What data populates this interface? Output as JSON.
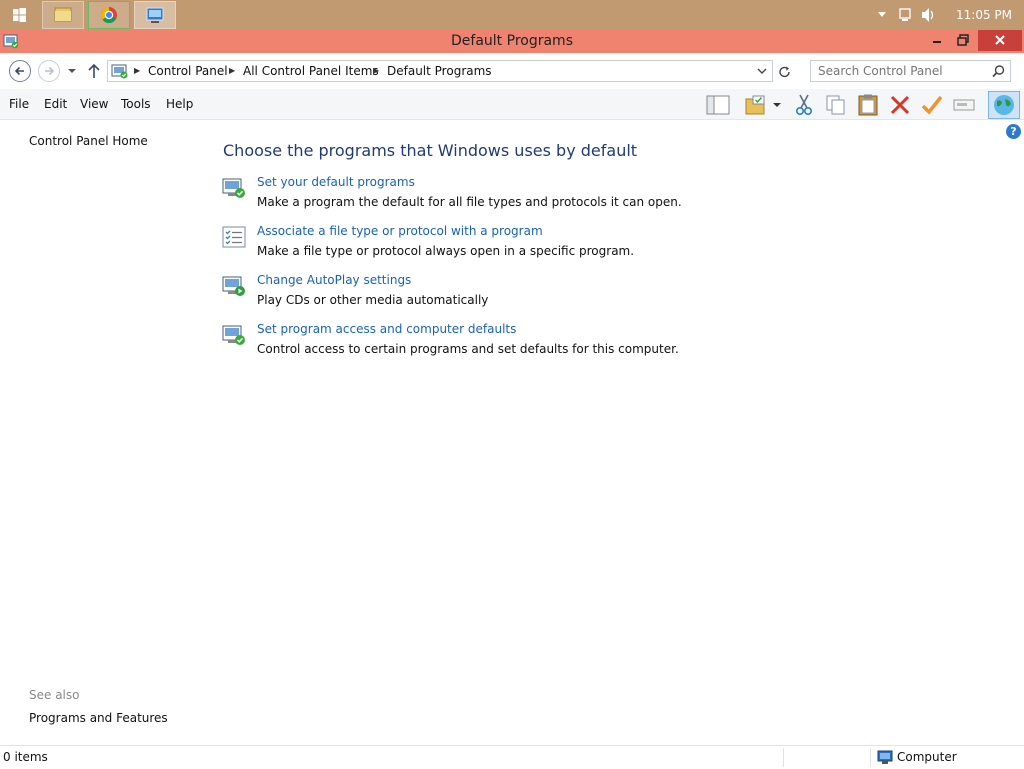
{
  "taskbar": {
    "apps": [
      "start-icon",
      "file-explorer-icon",
      "chrome-icon",
      "control-panel-icon"
    ],
    "clock": "11:05 PM",
    "tray_icons": [
      "chevron-up-icon",
      "network-icon",
      "volume-icon"
    ]
  },
  "window": {
    "title": "Default Programs",
    "title_color": "#f0836f"
  },
  "address": {
    "breadcrumb": [
      "Control Panel",
      "All Control Panel Items",
      "Default Programs"
    ],
    "search_placeholder": "Search Control Panel"
  },
  "menu": {
    "items": [
      "File",
      "Edit",
      "View",
      "Tools",
      "Help"
    ]
  },
  "toolbar": {
    "icons": [
      "layout-icon",
      "folder-options-icon",
      "cut-icon",
      "copy-icon",
      "paste-icon",
      "delete-icon",
      "checkmark-icon",
      "rename-icon",
      "globe-icon"
    ]
  },
  "sidebar": {
    "home_label": "Control Panel Home",
    "see_also_label": "See also",
    "see_also_items": [
      "Programs and Features"
    ]
  },
  "main": {
    "title": "Choose the programs that Windows uses by default",
    "tasks": [
      {
        "link": "Set your default programs",
        "desc": "Make a program the default for all file types and protocols it can open."
      },
      {
        "link": "Associate a file type or protocol with a program",
        "desc": "Make a file type or protocol always open in a specific program."
      },
      {
        "link": "Change AutoPlay settings",
        "desc": "Play CDs or other media automatically"
      },
      {
        "link": "Set program access and computer defaults",
        "desc": "Control access to certain programs and set defaults for this computer."
      }
    ]
  },
  "status": {
    "items": "0 items",
    "zone": "Computer"
  }
}
